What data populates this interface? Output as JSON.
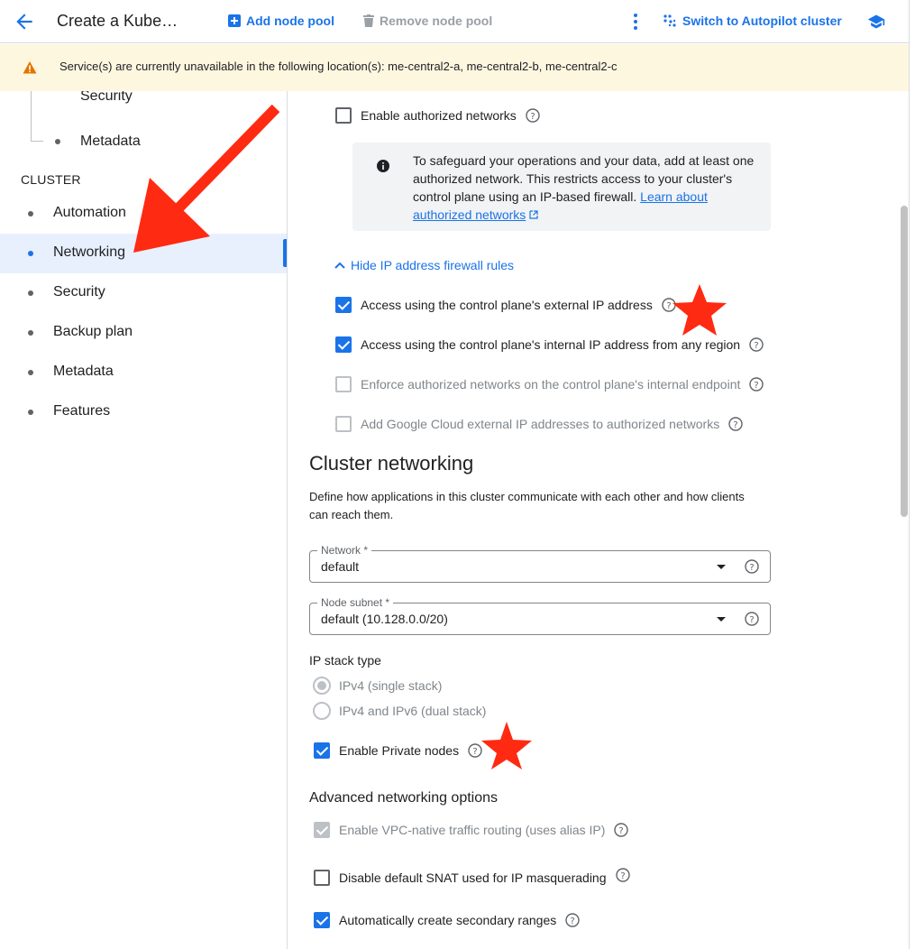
{
  "topbar": {
    "title": "Create a Kube…",
    "add_node_pool": "Add node pool",
    "remove_node_pool": "Remove node pool",
    "switch_autopilot": "Switch to Autopilot cluster"
  },
  "banner": {
    "message": "Service(s) are currently unavailable in the following location(s): me-central2-a, me-central2-b, me-central2-c"
  },
  "sidebar": {
    "clipped_item": "Security",
    "sub_item": "Metadata",
    "section": "CLUSTER",
    "items": [
      {
        "label": "Automation",
        "active": false
      },
      {
        "label": "Networking",
        "active": true
      },
      {
        "label": "Security",
        "active": false
      },
      {
        "label": "Backup plan",
        "active": false
      },
      {
        "label": "Metadata",
        "active": false
      },
      {
        "label": "Features",
        "active": false
      }
    ]
  },
  "main": {
    "enable_authorized_networks": {
      "label": "Enable authorized networks",
      "checked": false
    },
    "info": {
      "text": "To safeguard your operations and your data, add at least one authorized network. This restricts access to your cluster's control plane using an IP-based firewall.",
      "link1": "Learn about",
      "link2": "authorized networks"
    },
    "hide_firewall_rules": "Hide IP address firewall rules",
    "firewall": [
      {
        "label": "Access using the control plane's external IP address",
        "checked": true,
        "disabled": false
      },
      {
        "label": "Access using the control plane's internal IP address from any region",
        "checked": true,
        "disabled": false
      },
      {
        "label": "Enforce authorized networks on the control plane's internal endpoint",
        "checked": false,
        "disabled": true
      },
      {
        "label": "Add Google Cloud external IP addresses to authorized networks",
        "checked": false,
        "disabled": true
      }
    ],
    "cluster_networking": {
      "title": "Cluster networking",
      "description": "Define how applications in this cluster communicate with each other and how clients can reach them."
    },
    "network": {
      "label": "Network *",
      "value": "default"
    },
    "node_subnet": {
      "label": "Node subnet *",
      "value": "default (10.128.0.0/20)"
    },
    "ip_stack": {
      "title": "IP stack type",
      "options": [
        {
          "label": "IPv4 (single stack)",
          "selected": true
        },
        {
          "label": "IPv4 and IPv6 (dual stack)",
          "selected": false
        }
      ]
    },
    "private_nodes": {
      "label": "Enable Private nodes",
      "checked": true
    },
    "advanced": {
      "title": "Advanced networking options",
      "vpc_native": {
        "label": "Enable VPC-native traffic routing (uses alias IP)",
        "checked": true,
        "disabled": true
      },
      "disable_snat": {
        "label": "Disable default SNAT used for IP masquerading",
        "checked": false
      },
      "auto_secondary": {
        "label": "Automatically create secondary ranges",
        "checked": true
      }
    }
  },
  "colors": {
    "accent": "#1a73e8",
    "annotation": "#ff2a12",
    "banner_bg": "#fef7e0",
    "warning": "#e37400"
  }
}
